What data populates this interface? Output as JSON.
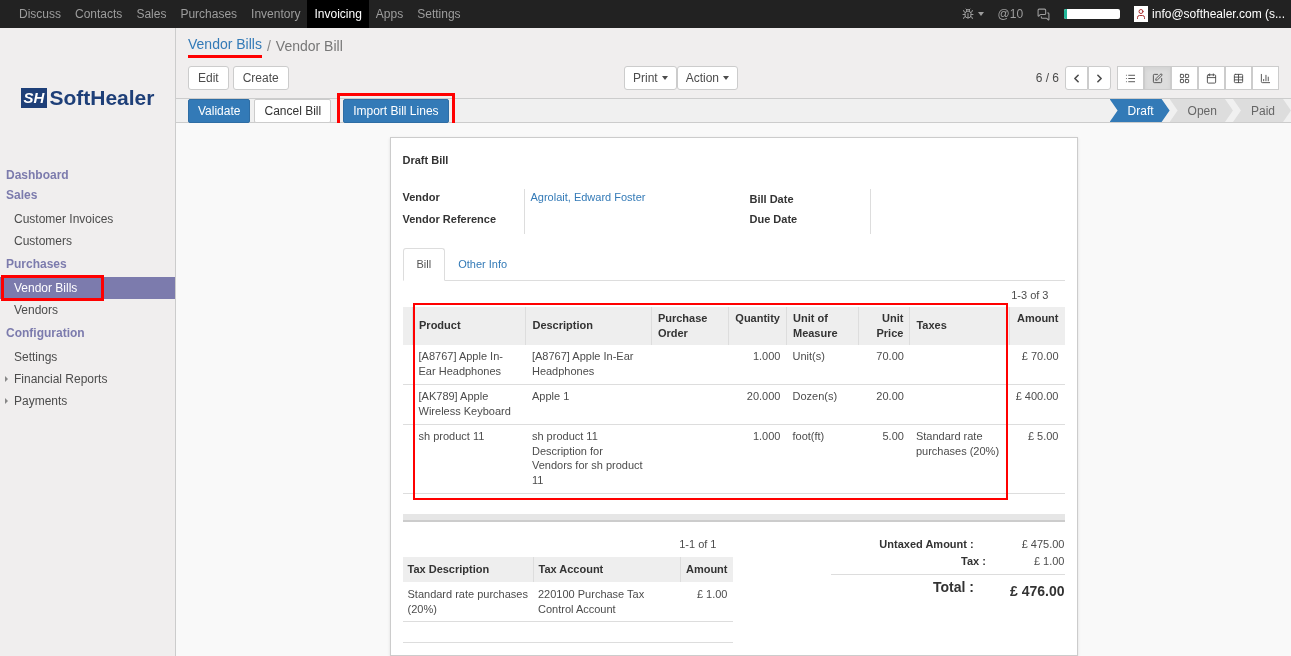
{
  "top_menu": [
    {
      "label": "Discuss",
      "selected": false
    },
    {
      "label": "Contacts",
      "selected": false
    },
    {
      "label": "Sales",
      "selected": false
    },
    {
      "label": "Purchases",
      "selected": false
    },
    {
      "label": "Inventory",
      "selected": false
    },
    {
      "label": "Invoicing",
      "selected": true
    },
    {
      "label": "Apps",
      "selected": false
    },
    {
      "label": "Settings",
      "selected": false
    }
  ],
  "systray": {
    "mentions": "@10",
    "progress": {
      "level": 0.05
    },
    "user": "info@softhealer.com (s..."
  },
  "logo": {
    "mark": "SH",
    "text": "SoftHealer"
  },
  "sidebar": {
    "sections": [
      {
        "title": "Dashboard"
      },
      {
        "title": "Sales",
        "items": [
          {
            "label": "Customer Invoices",
            "kind": "leaf",
            "selected": false,
            "highlighted": false
          },
          {
            "label": "Customers",
            "kind": "leaf",
            "selected": false,
            "highlighted": false
          }
        ]
      },
      {
        "title": "Purchases",
        "items": [
          {
            "label": "Vendor Bills",
            "kind": "leaf",
            "selected": true,
            "highlighted": true
          },
          {
            "label": "Vendors",
            "kind": "leaf",
            "selected": false,
            "highlighted": false
          }
        ]
      },
      {
        "title": "Configuration",
        "items": [
          {
            "label": "Settings",
            "kind": "leaf",
            "selected": false,
            "highlighted": false
          },
          {
            "label": "Financial Reports",
            "kind": "folder",
            "selected": false,
            "highlighted": false
          },
          {
            "label": "Payments",
            "kind": "folder",
            "selected": false,
            "highlighted": false
          }
        ]
      }
    ]
  },
  "breadcrumb_separator": "/",
  "breadcrumbs": [
    {
      "label": "Vendor Bills",
      "kind": "link",
      "highlighted": true
    },
    {
      "label": "Vendor Bill",
      "kind": "current",
      "highlighted": false
    }
  ],
  "actions": [
    "Edit",
    "Create"
  ],
  "dropdowns": [
    "Print",
    "Action"
  ],
  "pager": "6 / 6",
  "views": [
    {
      "kind": "list",
      "selected": false
    },
    {
      "kind": "form",
      "selected": true
    },
    {
      "kind": "kanban",
      "selected": false
    },
    {
      "kind": "calendar",
      "selected": false
    },
    {
      "kind": "pivot",
      "selected": false
    },
    {
      "kind": "graph",
      "selected": false
    }
  ],
  "header_buttons": [
    {
      "label": "Validate",
      "kind": "primary",
      "highlighted": false
    },
    {
      "label": "Cancel Bill",
      "kind": "default",
      "highlighted": false
    },
    {
      "label": "Import Bill Lines",
      "kind": "primary",
      "highlighted": true
    }
  ],
  "stages": [
    {
      "label": "Draft",
      "selected": true
    },
    {
      "label": "Open",
      "selected": false
    },
    {
      "label": "Paid",
      "selected": false
    }
  ],
  "form": {
    "title": "Draft Bill",
    "left_fields": [
      {
        "label": "Vendor",
        "value": "Agrolait, Edward Foster"
      },
      {
        "label": "Vendor Reference"
      }
    ],
    "right_fields": [
      {
        "label": "Bill Date"
      },
      {
        "label": "Due Date"
      }
    ],
    "tabs": [
      {
        "label": "Bill",
        "selected": true
      },
      {
        "label": "Other Info",
        "selected": false
      }
    ],
    "lines": {
      "pager": "1-3 of 3",
      "highlighted": true,
      "columns": [
        {
          "label": "Product",
          "kind": "text"
        },
        {
          "label": "Description",
          "kind": "text"
        },
        {
          "label": "Purchase Order",
          "kind": "text"
        },
        {
          "label": "Quantity",
          "kind": "number"
        },
        {
          "label": "Unit of Measure",
          "kind": "text"
        },
        {
          "label": "Unit Price",
          "kind": "number"
        },
        {
          "label": "Taxes",
          "kind": "text"
        },
        {
          "label": "Amount",
          "kind": "number"
        }
      ],
      "rows": [
        [
          "[A8767] Apple In-Ear Headphones",
          "[A8767] Apple In-Ear Headphones",
          "",
          "1.000",
          "Unit(s)",
          "70.00",
          "",
          "£ 70.00"
        ],
        [
          "[AK789] Apple Wireless Keyboard",
          "Apple 1",
          "",
          "20.000",
          "Dozen(s)",
          "20.00",
          "",
          "£ 400.00"
        ],
        [
          "sh product 11",
          "sh product 11 Description for Vendors for sh product 11",
          "",
          "1.000",
          "foot(ft)",
          "5.00",
          "Standard rate purchases (20%)",
          "£ 5.00"
        ]
      ]
    },
    "taxes": {
      "pager": "1-1 of 1",
      "columns": [
        {
          "label": "Tax Description",
          "kind": "text"
        },
        {
          "label": "Tax Account",
          "kind": "text"
        },
        {
          "label": "Amount",
          "kind": "number"
        }
      ],
      "rows": [
        [
          "Standard rate purchases (20%)",
          "220100 Purchase Tax Control Account",
          "£ 1.00"
        ]
      ]
    },
    "totals": [
      {
        "label": "Untaxed Amount :",
        "value": "£ 475.00",
        "kind": "sub"
      },
      {
        "label": "Tax :",
        "value": "£ 1.00",
        "kind": "sub"
      },
      {
        "label": "Total :",
        "value": "£ 476.00",
        "kind": "grand"
      }
    ]
  }
}
